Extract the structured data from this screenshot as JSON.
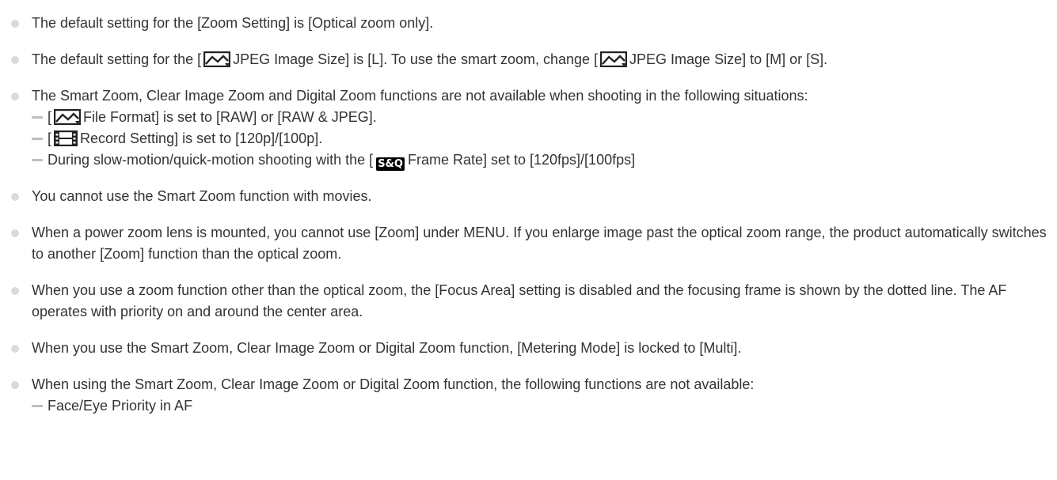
{
  "notes": [
    {
      "text": "The default setting for the [Zoom Setting] is [Optical zoom only]."
    },
    {
      "part1": "The default setting for the [",
      "icon1": "still-image-icon",
      "part2": "JPEG Image Size] is [L]. To use the smart zoom, change [",
      "icon2": "still-image-icon",
      "part3": "JPEG Image Size] to [M] or [S]."
    },
    {
      "text": "The Smart Zoom, Clear Image Zoom and Digital Zoom functions are not available when shooting in the following situations:",
      "sub": [
        {
          "pre": "[",
          "icon": "still-image-icon",
          "post": "File Format] is set to [RAW] or [RAW & JPEG]."
        },
        {
          "pre": "[",
          "icon": "movie-film-icon",
          "post": "Record Setting] is set to [120p]/[100p]."
        },
        {
          "pre": "During slow-motion/quick-motion shooting with the [",
          "icon_label": "S&Q",
          "post": "Frame Rate] set to [120fps]/[100fps]"
        }
      ]
    },
    {
      "text": "You cannot use the Smart Zoom function with movies."
    },
    {
      "text": "When a power zoom lens is mounted, you cannot use [Zoom] under MENU. If you enlarge image past the optical zoom range, the product automatically switches to another [Zoom] function than the optical zoom."
    },
    {
      "text": "When you use a zoom function other than the optical zoom, the [Focus Area] setting is disabled and the focusing frame is shown by the dotted line. The AF operates with priority on and around the center area."
    },
    {
      "text": "When you use the Smart Zoom, Clear Image Zoom or Digital Zoom function, [Metering Mode] is locked to [Multi]."
    },
    {
      "text": "When using the Smart Zoom, Clear Image Zoom or Digital Zoom function, the following functions are not available:",
      "sub": [
        {
          "text": "Face/Eye Priority in AF"
        }
      ]
    }
  ],
  "colors": {
    "text": "#333333",
    "bullet": "#dadada",
    "dash": "#bfbfbf"
  }
}
